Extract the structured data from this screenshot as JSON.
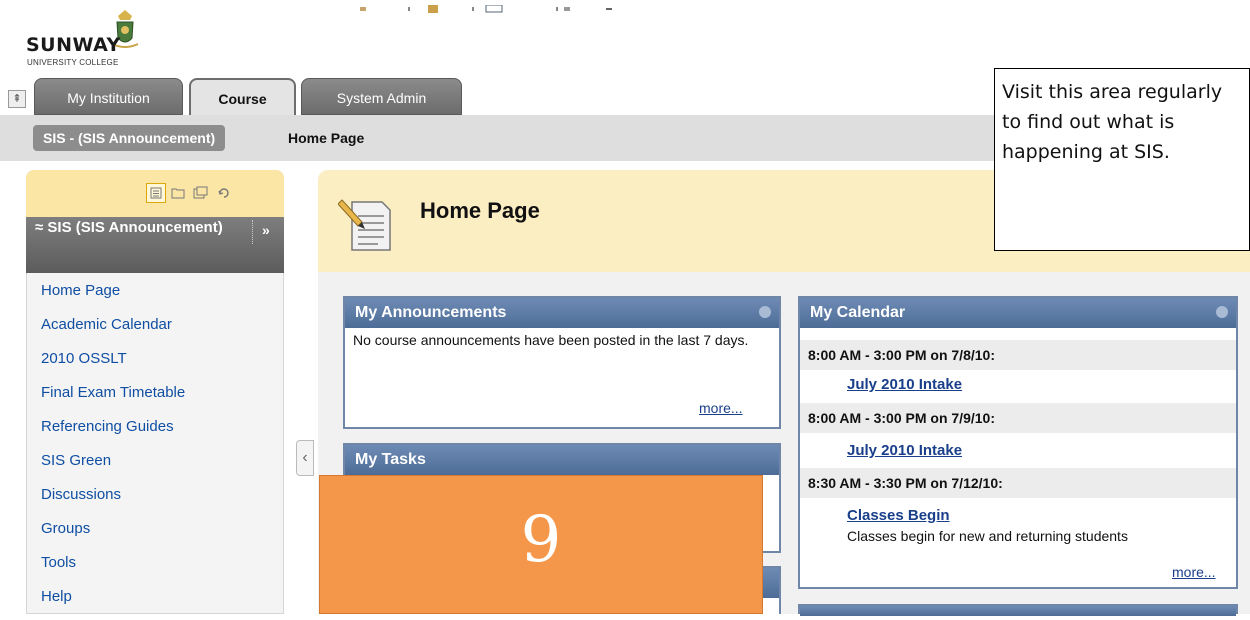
{
  "logo": {
    "word": "SUNWAY",
    "sub": "UNIVERSITY COLLEGE"
  },
  "tabs": [
    {
      "label": "My Institution",
      "active": false
    },
    {
      "label": "Course",
      "active": true
    },
    {
      "label": "System Admin",
      "active": false
    }
  ],
  "breadcrumb": {
    "course": "SIS - (SIS Announcement)",
    "page": "Home Page"
  },
  "menu": {
    "title": "SIS (SIS Announcement)",
    "title_arrow": "»",
    "items": [
      "Home Page",
      "Academic Calendar",
      "2010 OSSLT",
      "Final Exam Timetable",
      "Referencing Guides",
      "SIS Green",
      "Discussions",
      "Groups",
      "Tools",
      "Help"
    ]
  },
  "page": {
    "title": "Home Page"
  },
  "announcements": {
    "header": "My Announcements",
    "text": "No course announcements have been posted in the last 7 days.",
    "more": "more..."
  },
  "tasks": {
    "header": "My Tasks"
  },
  "calendar": {
    "header": "My Calendar",
    "events": [
      {
        "time": "8:00 AM - 3:00 PM on 7/8/10:",
        "title": "July 2010 Intake",
        "desc": ""
      },
      {
        "time": "8:00 AM - 3:00 PM on 7/9/10:",
        "title": "July 2010 Intake",
        "desc": ""
      },
      {
        "time": "8:30 AM - 3:30 PM on 7/12/10:",
        "title": "Classes Begin",
        "desc": "Classes begin for new and returning students"
      }
    ],
    "more": "more..."
  },
  "callout": {
    "text": "Visit this area regularly\nto find out what is\nhappening at SIS."
  },
  "step_marker": {
    "number": "9"
  },
  "colors": {
    "link": "#0f4ea3",
    "module_header": "#5a78a3",
    "title_bar": "#fbeec3",
    "overlay": "#f5974a"
  }
}
